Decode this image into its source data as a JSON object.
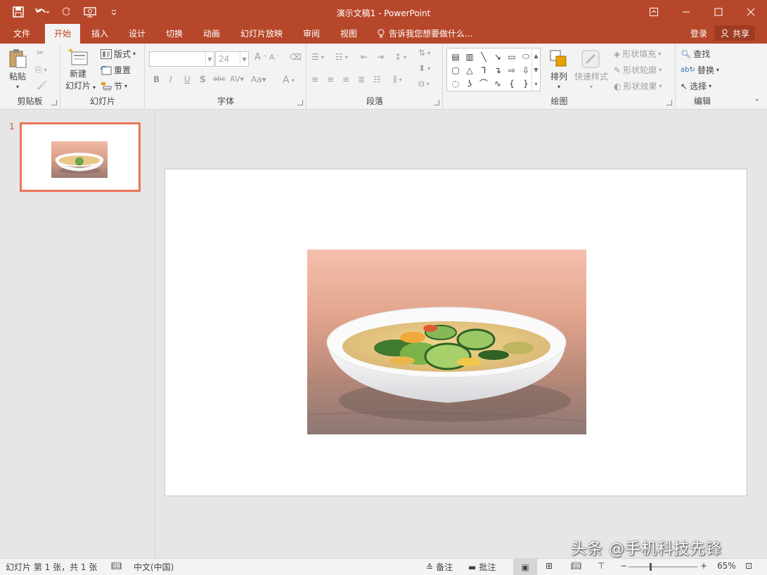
{
  "window": {
    "title": "演示文稿1 - PowerPoint"
  },
  "tabs": [
    {
      "label": "文件"
    },
    {
      "label": "开始"
    },
    {
      "label": "插入"
    },
    {
      "label": "设计"
    },
    {
      "label": "切换"
    },
    {
      "label": "动画"
    },
    {
      "label": "幻灯片放映"
    },
    {
      "label": "审阅"
    },
    {
      "label": "视图"
    }
  ],
  "tell_me": "告诉我您想要做什么...",
  "account": {
    "login": "登录",
    "share": "共享"
  },
  "ribbon": {
    "clipboard": {
      "label": "剪贴板",
      "paste": "粘贴"
    },
    "slides": {
      "label": "幻灯片",
      "new_slide_line1": "新建",
      "new_slide_line2": "幻灯片",
      "layout": "版式",
      "reset": "重置",
      "section": "节"
    },
    "font": {
      "label": "字体",
      "font_name": "",
      "font_size": "24"
    },
    "paragraph": {
      "label": "段落"
    },
    "drawing": {
      "label": "绘图",
      "arrange": "排列",
      "quick_styles": "快速样式",
      "shape_fill": "形状填充",
      "shape_outline": "形状轮廓",
      "shape_effects": "形状效果"
    },
    "editing": {
      "label": "编辑",
      "find": "查找",
      "replace": "替换",
      "select": "选择"
    }
  },
  "thumbnails": [
    {
      "number": "1"
    }
  ],
  "status": {
    "slide_info": "幻灯片 第 1 张，共 1 张",
    "language": "中文(中国)",
    "notes": "备注",
    "comments": "批注",
    "zoom": "65%"
  },
  "watermark": "头条 @手机科技先锋",
  "colors": {
    "accent": "#b7472a",
    "thumb_border": "#e8765a"
  }
}
